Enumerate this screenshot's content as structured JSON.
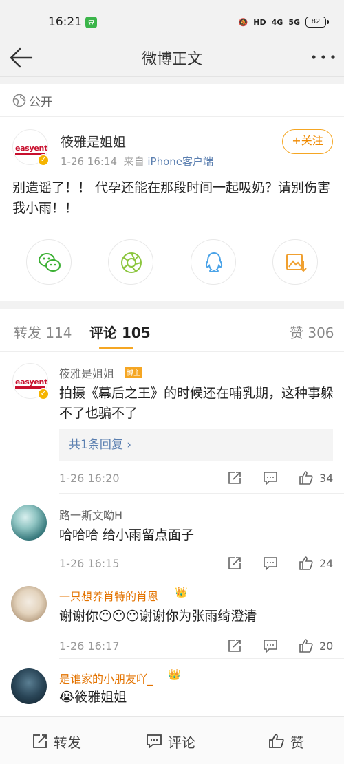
{
  "status_bar": {
    "time": "16:21",
    "app_badge": "豆",
    "hd": "HD",
    "net1": "4G",
    "net2": "5G",
    "battery": "82"
  },
  "nav": {
    "title": "微博正文",
    "back_icon": "back-arrow-icon",
    "more_icon": "more-dots-icon"
  },
  "visibility": {
    "icon": "globe-icon",
    "label": "公开"
  },
  "post": {
    "author": "筱雅是姐姐",
    "avatar_brand": "easyent",
    "time": "1-26 16:14",
    "source_prefix": "来自",
    "source": "iPhone客户端",
    "follow_label": "+关注",
    "text": "别造谣了！！ 代孕还能在那段时间一起吸奶？请别伤害我小雨！！",
    "share_targets": [
      "wechat-icon",
      "moments-icon",
      "qq-icon",
      "save-image-icon"
    ]
  },
  "tabs": [
    {
      "label": "转发",
      "count": "114"
    },
    {
      "label": "评论",
      "count": "105",
      "active": true
    },
    {
      "label": "赞",
      "count": "306"
    }
  ],
  "comments": [
    {
      "name": "筱雅是姐姐",
      "badge": "博主",
      "text": "拍摄《幕后之王》的时候还在哺乳期，这种事躲不了也骗不了",
      "reply_box": "共1条回复 ›",
      "time": "1-26 16:20",
      "likes": "34"
    },
    {
      "name": "路一斯文呦H",
      "text": "哈哈哈 给小雨留点面子",
      "time": "1-26 16:15",
      "likes": "24"
    },
    {
      "name": "一只想养肖特的肖恩",
      "text": "谢谢你😶😶😶谢谢你为张雨绮澄清",
      "time": "1-26 16:17",
      "likes": "20"
    },
    {
      "name": "是谁家的小朋友吖_",
      "text": "😭筱雅姐姐"
    }
  ],
  "bottom_bar": {
    "repost": "转发",
    "comment": "评论",
    "like": "赞"
  },
  "colors": {
    "accent": "#f5a623",
    "link": "#5b7fb0",
    "vip_name": "#e37300",
    "verified": "#f5b400"
  }
}
